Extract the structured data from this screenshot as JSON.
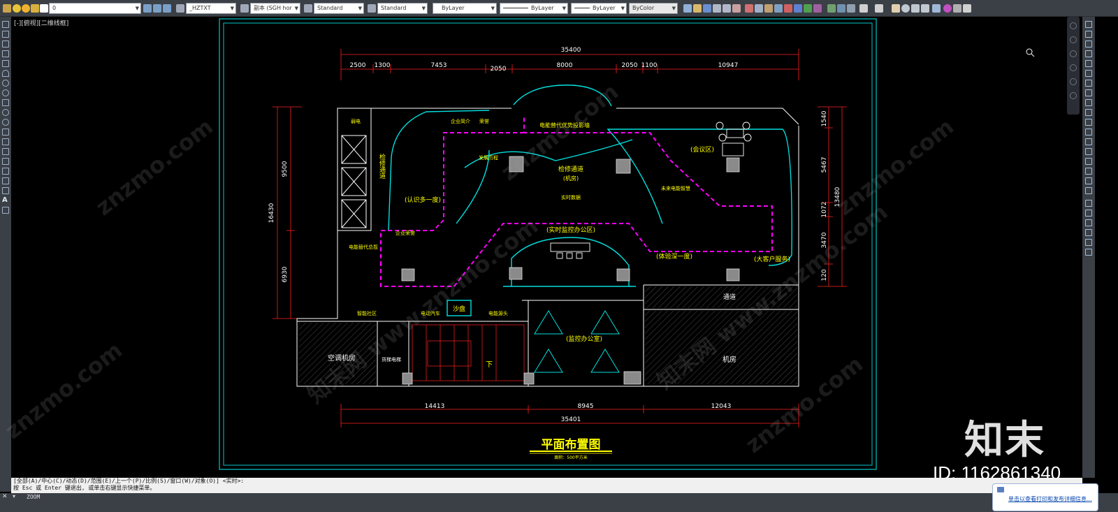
{
  "toolbar": {
    "layer_value": "0",
    "textstyle": "_HZTXT",
    "dimstyle": "副本 (SGH hor",
    "tablestyle": "Standard",
    "mleaderstyle": "Standard",
    "color": "ByLayer",
    "linetype": "ByLayer",
    "lineweight": "ByLayer",
    "plotstyle": "ByColor"
  },
  "viewport_label": "[-][俯视][二维线框]",
  "drawing": {
    "dims_top_overall": "35400",
    "dims_top": [
      "2500",
      "1300",
      "7453",
      "2050",
      "8000",
      "2050",
      "1100",
      "10947"
    ],
    "dims_bottom": [
      "14413",
      "8945",
      "12043"
    ],
    "dims_bottom_overall": "35401",
    "dims_left_overall": "16430",
    "dims_left": [
      "9500",
      "6930"
    ],
    "dims_right_overall": "13480",
    "dims_right": [
      "1540",
      "5467",
      "1072",
      "3470",
      "120"
    ],
    "rooms": {
      "ac_room": "空调机房",
      "elevator": "货梯电梯",
      "machine_room": "机房",
      "corridor": "通道",
      "monitor_office": "(监控办公室)",
      "realtime_office": "(实时监控办公区)",
      "meeting": "(会议区)",
      "sandbox": "沙盘",
      "recognize": "(认识多一度)",
      "experience": "(体验深一度)",
      "vip": "(大客户服务)",
      "inspection": "检修通道",
      "inspection_sub": "(机房)",
      "maintenance": "检修通道",
      "stair_down": "下",
      "main_screen": "电能替代优势投影墙",
      "development": "发展历程",
      "corp_intro": "企业简介",
      "cert": "荣誉",
      "future_tech": "未来电能智慧",
      "smart_community": "智能社区",
      "ev": "电动汽车",
      "power_source": "电能源头",
      "substitution": "电能替代总揽",
      "enterprise": "企业荣誉",
      "realtime_data": "实时数据",
      "elec_dist": "弱电"
    },
    "title": "平面布置图",
    "subtitle": "面积：500平方米"
  },
  "command": {
    "line1": "[全部(A)/中心(C)/动态(D)/范围(E)/上一个(P)/比例(S)/窗口(W)/对象(O)] <实时>:",
    "line2": "按 Esc 或 Enter 键退出, 或单击右键显示快捷菜单。",
    "input": "ZOOM"
  },
  "notice": {
    "link": "单击以查看打印和发布详细信息..."
  },
  "watermark": {
    "logo": "知末",
    "id": "ID: 1162861340",
    "site": "znzmo.com",
    "site_cn": "知末网 www.znzmo.com"
  }
}
